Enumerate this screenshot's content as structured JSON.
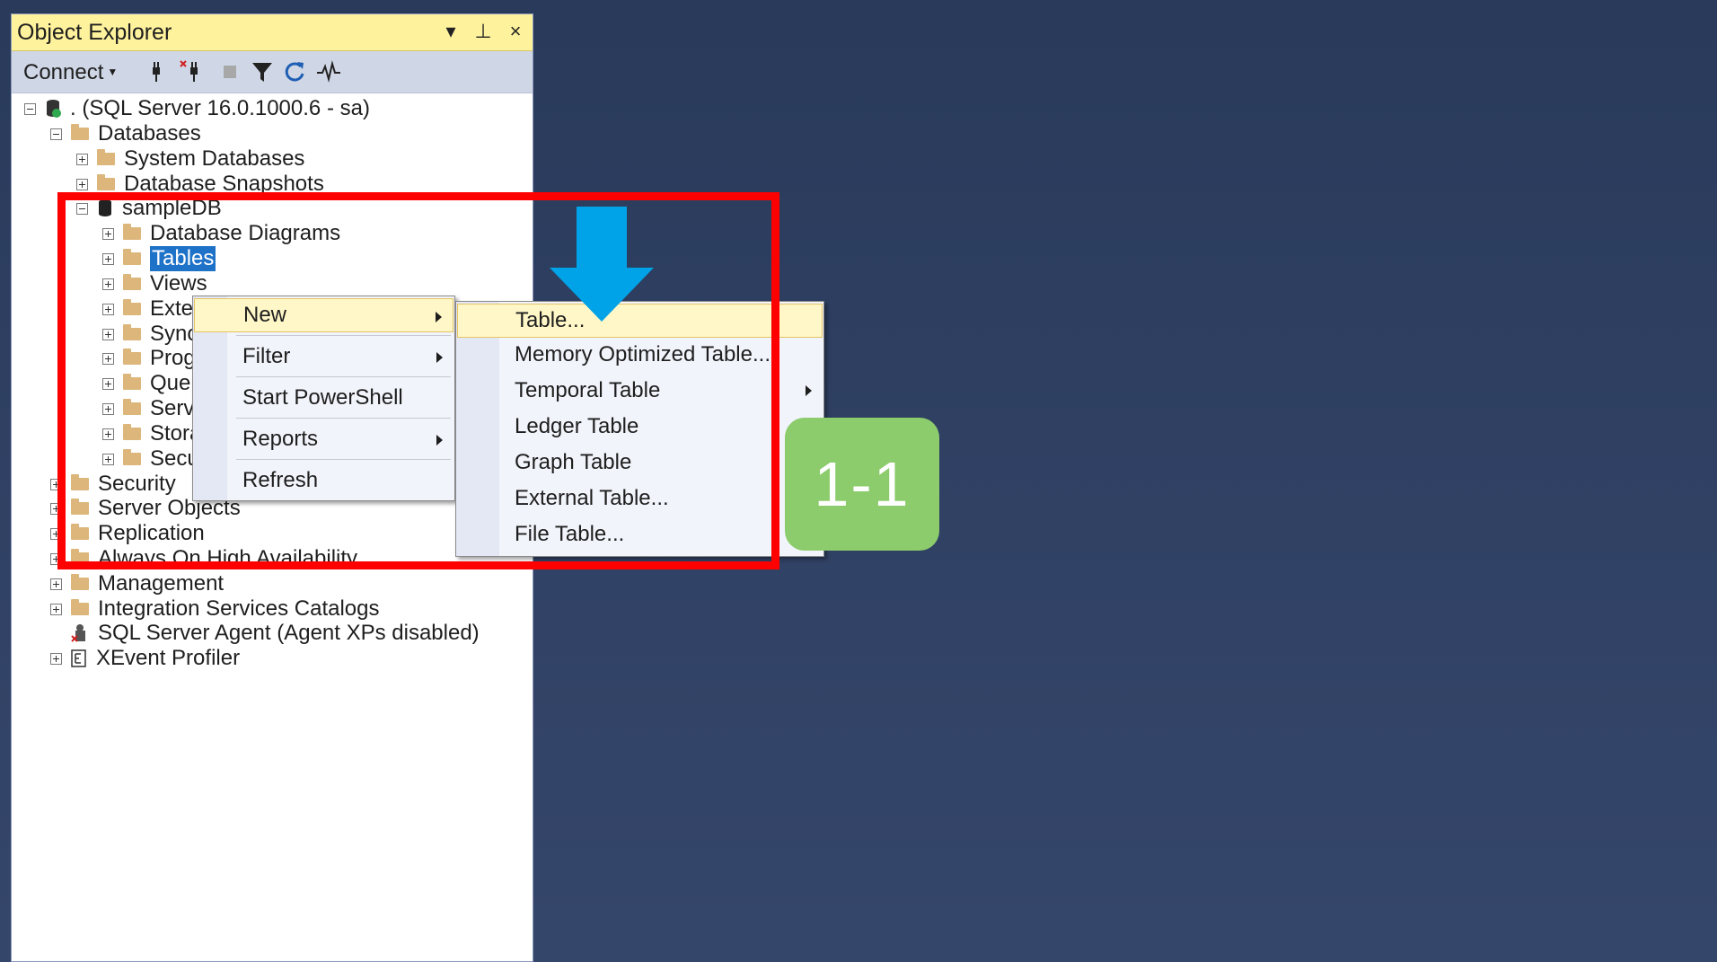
{
  "panel": {
    "title": "Object Explorer",
    "title_buttons": [
      "▾",
      "⊥",
      "×"
    ],
    "toolbar": {
      "connect_label": "Connect"
    }
  },
  "tree": [
    {
      "label": ". (SQL Server 16.0.1000.6 - sa)",
      "icon": "server-icon",
      "expander": "minus"
    },
    {
      "label": "Databases",
      "icon": "folder-icon",
      "expander": "minus"
    },
    {
      "label": "System Databases",
      "icon": "folder-icon",
      "expander": "plus"
    },
    {
      "label": "Database Snapshots",
      "icon": "folder-icon",
      "expander": "plus"
    },
    {
      "label": "sampleDB",
      "icon": "database-icon",
      "expander": "minus"
    },
    {
      "label": "Database Diagrams",
      "icon": "folder-icon",
      "expander": "plus"
    },
    {
      "label": "Tables",
      "icon": "folder-icon",
      "expander": "plus",
      "selected": true
    },
    {
      "label": "Views",
      "icon": "folder-icon",
      "expander": "plus"
    },
    {
      "label": "External Resources",
      "icon": "folder-icon",
      "expander": "plus"
    },
    {
      "label": "Synonyms",
      "icon": "folder-icon",
      "expander": "plus"
    },
    {
      "label": "Programmability",
      "icon": "folder-icon",
      "expander": "plus"
    },
    {
      "label": "Query Store",
      "icon": "folder-icon",
      "expander": "plus"
    },
    {
      "label": "Service Broker",
      "icon": "folder-icon",
      "expander": "plus"
    },
    {
      "label": "Storage",
      "icon": "folder-icon",
      "expander": "plus"
    },
    {
      "label": "Security",
      "icon": "folder-icon",
      "expander": "plus"
    },
    {
      "label": "Security",
      "icon": "folder-icon",
      "expander": "plus"
    },
    {
      "label": "Server Objects",
      "icon": "folder-icon",
      "expander": "plus"
    },
    {
      "label": "Replication",
      "icon": "folder-icon",
      "expander": "plus"
    },
    {
      "label": "Always On High Availability",
      "icon": "folder-icon",
      "expander": "plus"
    },
    {
      "label": "Management",
      "icon": "folder-icon",
      "expander": "plus"
    },
    {
      "label": "Integration Services Catalogs",
      "icon": "folder-icon",
      "expander": "plus"
    },
    {
      "label": "SQL Server Agent (Agent XPs disabled)",
      "icon": "agent-icon",
      "expander": "none"
    },
    {
      "label": "XEvent Profiler",
      "icon": "xevent-icon",
      "expander": "plus"
    }
  ],
  "context_menu": {
    "items": [
      {
        "label": "New",
        "submenu": true,
        "highlighted": true
      },
      {
        "label": "Filter",
        "submenu": true
      },
      {
        "label": "Start PowerShell",
        "submenu": false
      },
      {
        "label": "Reports",
        "submenu": true
      },
      {
        "label": "Refresh",
        "submenu": false
      }
    ]
  },
  "submenu_new": {
    "items": [
      {
        "label": "Table...",
        "highlighted": true
      },
      {
        "label": "Memory Optimized Table...",
        "submenu": false
      },
      {
        "label": "Temporal Table",
        "submenu": true
      },
      {
        "label": "Ledger Table",
        "submenu": false
      },
      {
        "label": "Graph Table",
        "submenu": false
      },
      {
        "label": "External Table...",
        "submenu": false
      },
      {
        "label": "File Table...",
        "submenu": false
      }
    ]
  },
  "annotation": {
    "badge_text": "1-1",
    "arrow_color": "#00a3e8",
    "box_color": "#ff0000",
    "badge_color": "#8ccc6c"
  }
}
